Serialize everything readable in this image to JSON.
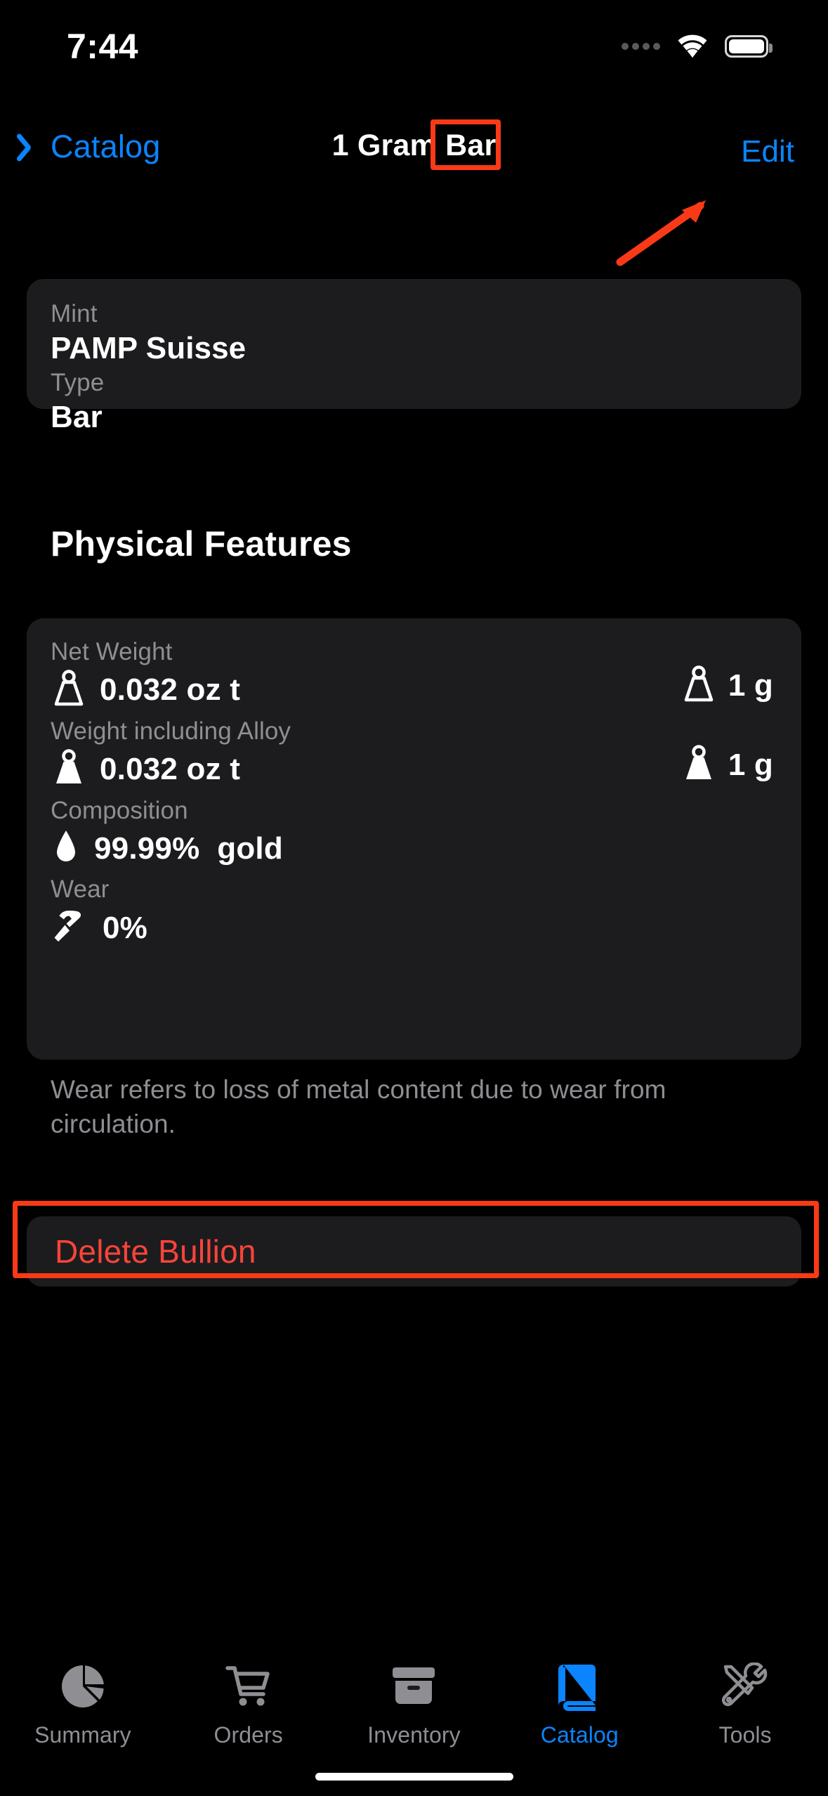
{
  "status_bar": {
    "time": "7:44",
    "signal_icon": "signal-dots-icon",
    "wifi_icon": "wifi-icon",
    "battery_icon": "battery-icon"
  },
  "nav_bar": {
    "back_icon": "chevron-left-icon",
    "back_label": "Catalog",
    "title": "1 Gram Bar",
    "edit_label": "Edit"
  },
  "annotations": {
    "edit_highlight_color": "#FA3A17",
    "arrow_color": "#FA3A17",
    "delete_highlight_color": "#FA3A17"
  },
  "identity_card": {
    "mint_label": "Mint",
    "mint_value": "PAMP Suisse",
    "type_label": "Type",
    "type_value": "Bar"
  },
  "physical_section": {
    "title": "Physical Features",
    "rows": [
      {
        "label": "Net Weight",
        "left_icon": "weight-outline-icon",
        "left_value": "0.032 oz t",
        "right_icon": "weight-outline-icon",
        "right_value": "1 g"
      },
      {
        "label": "Weight including Alloy",
        "left_icon": "weight-filled-icon",
        "left_value": "0.032 oz t",
        "right_icon": "weight-filled-icon",
        "right_value": "1 g"
      },
      {
        "label": "Composition",
        "left_icon": "droplet-icon",
        "left_value": "99.99%  gold",
        "right_icon": "",
        "right_value": ""
      },
      {
        "label": "Wear",
        "left_icon": "hammer-icon",
        "left_value": "0%",
        "right_icon": "",
        "right_value": ""
      }
    ],
    "footnote": "Wear refers to loss of metal content due to wear from circulation."
  },
  "delete_button": {
    "label": "Delete Bullion",
    "color": "#F8443A"
  },
  "tab_bar": {
    "active_color": "#0A84FF",
    "inactive_color": "#8E8E93",
    "tabs": [
      {
        "label": "Summary",
        "icon": "pie-chart-icon",
        "active": false
      },
      {
        "label": "Orders",
        "icon": "cart-icon",
        "active": false
      },
      {
        "label": "Inventory",
        "icon": "archivebox-icon",
        "active": false
      },
      {
        "label": "Catalog",
        "icon": "book-icon",
        "active": true
      },
      {
        "label": "Tools",
        "icon": "tools-icon",
        "active": false
      }
    ]
  }
}
